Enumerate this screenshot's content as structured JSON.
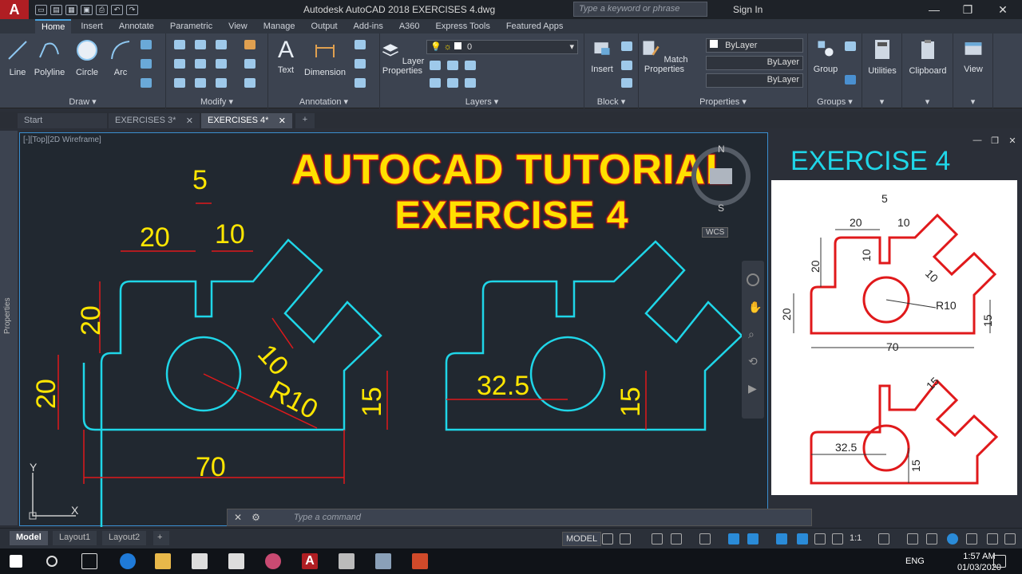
{
  "app": {
    "logo": "A",
    "title": "Autodesk AutoCAD 2018    EXERCISES 4.dwg",
    "search_placeholder": "Type a keyword or phrase",
    "sign_in": "Sign In"
  },
  "ribbon_tabs": [
    "Home",
    "Insert",
    "Annotate",
    "Parametric",
    "View",
    "Manage",
    "Output",
    "Add-ins",
    "A360",
    "Express Tools",
    "Featured Apps"
  ],
  "draw_tools": [
    "Line",
    "Polyline",
    "Circle",
    "Arc"
  ],
  "panels": {
    "draw": "Draw ▾",
    "modify": "Modify ▾",
    "annotation": "Annotation ▾",
    "layers": "Layers ▾",
    "block": "Block ▾",
    "properties": "Properties ▾",
    "groups": "Groups ▾"
  },
  "annotation_tools": [
    "Text",
    "Dimension"
  ],
  "layer_properties": "Layer Properties",
  "layer_current": "0",
  "insert_label": "Insert",
  "match_properties": "Match Properties",
  "bylayer": [
    "ByLayer",
    "ByLayer",
    "ByLayer"
  ],
  "group_label": "Group",
  "utilities": "Utilities",
  "clipboard": "Clipboard",
  "view": "View",
  "doc_tabs": [
    "Start",
    "EXERCISES 3*",
    "EXERCISES 4*"
  ],
  "viewport_label": "[-][Top][2D Wireframe]",
  "side_palette": "Properties",
  "heading": {
    "line1": "AUTOCAD TUTORIAL",
    "line2": "EXERCISE 4"
  },
  "exercise_title": "EXERCISE 4",
  "viewcube": {
    "north": "N",
    "south": "S",
    "wcs": "WCS"
  },
  "ucs": {
    "x": "X",
    "y": "Y"
  },
  "cad_dims": {
    "d5": "5",
    "d20_top": "20",
    "d10_top": "10",
    "d20_left": "20",
    "d20_left2": "20",
    "d10_slot": "10",
    "r10": "R10",
    "d15": "15",
    "d70": "70",
    "d32_5": "32.5",
    "d15_b": "15"
  },
  "ref_dims": {
    "d5": "5",
    "d20": "20",
    "d10": "10",
    "d10v": "10",
    "d10s": "10",
    "d20v": "20",
    "d20v2": "20",
    "r10": "R10",
    "d15": "15",
    "d70": "70",
    "d15b": "15",
    "d32_5": "32.5",
    "d15c": "15"
  },
  "command_placeholder": "Type a command",
  "layout_tabs": [
    "Model",
    "Layout1",
    "Layout2"
  ],
  "status": {
    "model": "MODEL",
    "scale": "1:1"
  },
  "taskbar": {
    "lang": "ENG",
    "time": "1:57 AM",
    "date": "01/03/2020"
  },
  "colors": {
    "cad_outline": "#1fd6e8",
    "dimension": "#e0191b",
    "dim_text": "#ffe600",
    "heading_fill": "#ffe000",
    "heading_stroke": "#c8191b",
    "ref_outline": "#e0191b"
  }
}
